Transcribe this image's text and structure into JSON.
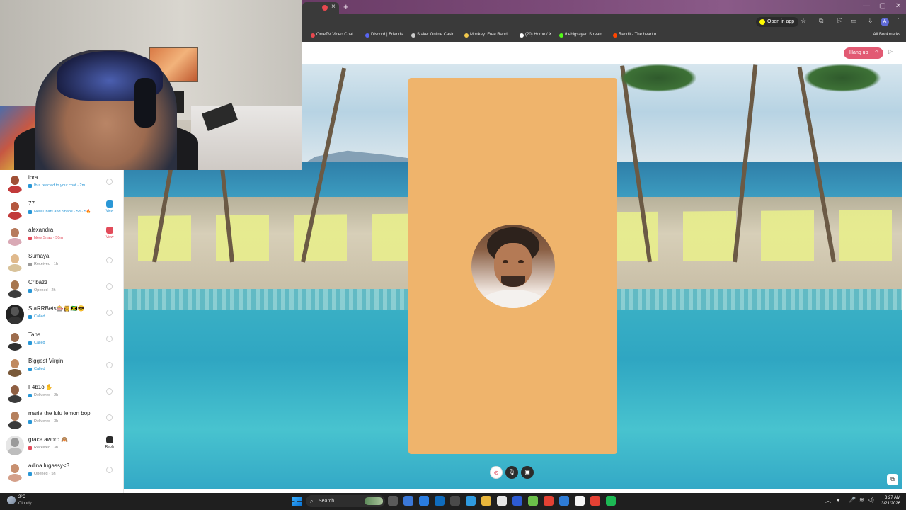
{
  "browser": {
    "open_in_app": "Open in app",
    "bookmarks": [
      {
        "label": "OmeTV Video Chat...",
        "color": "#e8484f"
      },
      {
        "label": "Discord | Friends",
        "color": "#5865f2"
      },
      {
        "label": "Stake: Online Casin...",
        "color": "#cccccc"
      },
      {
        "label": "Monkey: Free Rand...",
        "color": "#f2c94c"
      },
      {
        "label": "(20) Home / X",
        "color": "#ffffff"
      },
      {
        "label": "thebigsayan Stream...",
        "color": "#53fc18"
      },
      {
        "label": "Reddit - The heart o...",
        "color": "#ff4500"
      }
    ],
    "all_bookmarks": "All Bookmarks",
    "profile_initial": "A"
  },
  "call": {
    "hang_up": "Hang up"
  },
  "chats": [
    {
      "name": "ibra",
      "status": "Ibra reacted to your chat · 2m",
      "status_style": "blue",
      "status_color": "#2a97d6",
      "action": "circle",
      "avatar": "#ffffff",
      "face": "#a05036",
      "shirt": "#c23a3a"
    },
    {
      "name": "77",
      "status": "New Chats and Snaps · 5d · 5🔥",
      "status_style": "blue",
      "status_color": "#2a97d6",
      "action": "view",
      "view_label": "View",
      "view_color": "#2a97d6",
      "avatar": "#ffffff",
      "face": "#b4573f",
      "shirt": "#c23a3a"
    },
    {
      "name": "alexandra",
      "status": "New Snap · 50m",
      "status_style": "red",
      "status_color": "#e24b5a",
      "action": "view",
      "view_label": "View",
      "view_color": "#e24b5a",
      "avatar": "#ffffff",
      "face": "#b77a5c",
      "shirt": "#d9a9b5"
    },
    {
      "name": "Sumaya",
      "status": "Received · 1h",
      "status_style": "",
      "status_color": "#9a9a9a",
      "action": "circle",
      "avatar": "#ffffff",
      "face": "#e0b98c",
      "shirt": "#d8c29a"
    },
    {
      "name": "Cribazz",
      "status": "Opened · 2h",
      "status_style": "",
      "status_color": "#2a97d6",
      "action": "circle",
      "avatar": "#ffffff",
      "face": "#a7764f",
      "shirt": "#3c3c3c"
    },
    {
      "name": "StaRRBets🎰👸🇯🇲😎",
      "status": "Called",
      "status_style": "blue",
      "status_color": "#2a97d6",
      "action": "circle",
      "avatar": "#222222",
      "face": "#555555",
      "shirt": "#333333"
    },
    {
      "name": "Taha",
      "status": "Called",
      "status_style": "blue",
      "status_color": "#2a97d6",
      "action": "circle",
      "avatar": "#ffffff",
      "face": "#9d6d4d",
      "shirt": "#2f2f2f"
    },
    {
      "name": "Biggest Virgin",
      "status": "Called",
      "status_style": "blue",
      "status_color": "#2a97d6",
      "action": "circle",
      "avatar": "#ffffff",
      "face": "#c08a60",
      "shirt": "#7a5a3a"
    },
    {
      "name": "F4b1o ✋",
      "status": "Delivered · 2h",
      "status_style": "",
      "status_color": "#2a97d6",
      "action": "circle",
      "avatar": "#ffffff",
      "face": "#8f5f42",
      "shirt": "#3b3b3b"
    },
    {
      "name": "maria the lulu lemon bop",
      "status": "Delivered · 3h",
      "status_style": "",
      "status_color": "#2a97d6",
      "action": "circle",
      "avatar": "#ffffff",
      "face": "#b5805d",
      "shirt": "#3a3a3a"
    },
    {
      "name": "grace aworo 🙈",
      "status": "Received · 3h",
      "status_style": "",
      "status_color": "#e24b5a",
      "action": "reply",
      "view_label": "Reply",
      "view_color": "#2b2b2b",
      "avatar": "#e6e6e6",
      "face": "#9a9a9a",
      "shirt": "#bdbdbd"
    },
    {
      "name": "adina lugassy<3",
      "status": "Opened · 5h",
      "status_style": "",
      "status_color": "#2a97d6",
      "action": "circle",
      "avatar": "#ffffff",
      "face": "#c89070",
      "shirt": "#d4a08a"
    }
  ],
  "taskbar": {
    "temp": "2°C",
    "condition": "Cloudy",
    "search": "Search",
    "time": "3:27 AM",
    "date": "3/21/2026",
    "apps": [
      "#5a5a5a",
      "#3b78d8",
      "#2a7de1",
      "#0f6cbd",
      "#4a4a4a",
      "#2f9be0",
      "#e8b63c",
      "#e6e6e6",
      "#2d5bd3",
      "#6cc04a",
      "#e34133",
      "#2e7cd6",
      "#f5f5f5",
      "#e44134",
      "#1db954"
    ]
  }
}
